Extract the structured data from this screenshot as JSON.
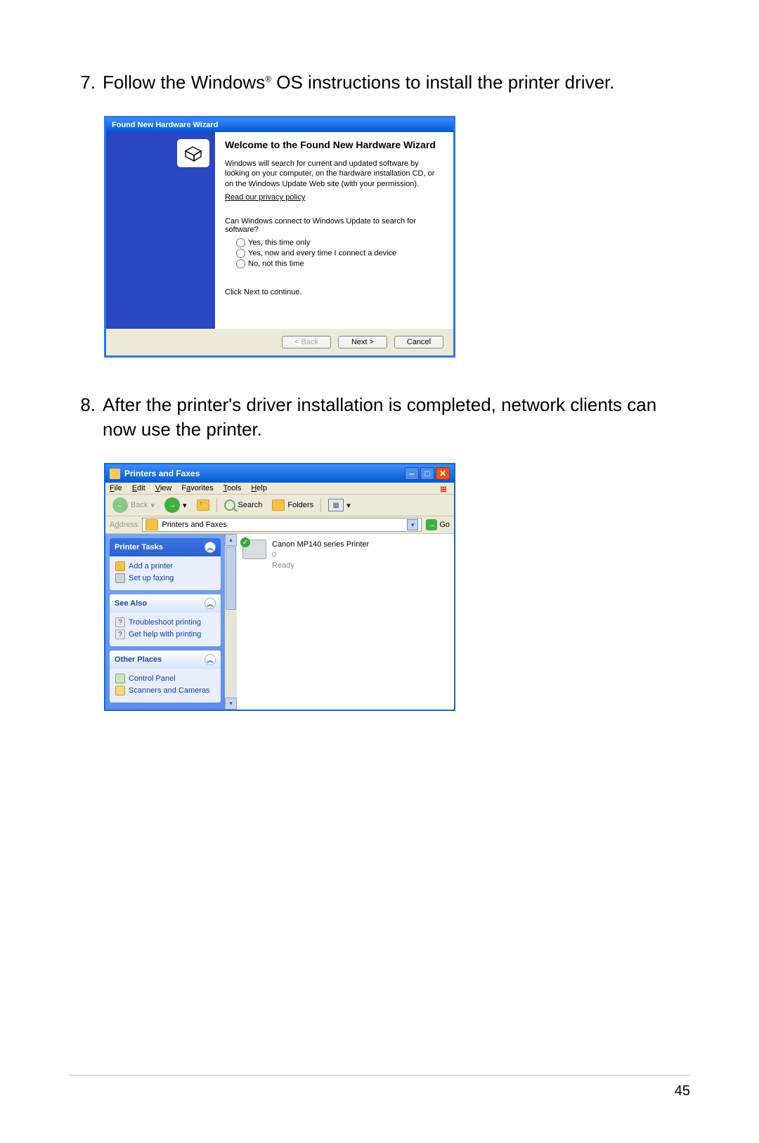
{
  "steps": {
    "s7_num": "7.",
    "s7_a": "Follow the Windows",
    "s7_reg": "®",
    "s7_b": " OS instructions to install the printer driver.",
    "s8_num": "8.",
    "s8": "After the printer's driver installation is completed, network clients can now use the printer."
  },
  "wizard": {
    "title": "Found New Hardware Wizard",
    "heading": "Welcome to the Found New Hardware Wizard",
    "para": "Windows will search for current and updated software by looking on your computer, on the hardware installation CD, or on the Windows Update Web site (with your permission).",
    "privacy": "Read our privacy policy",
    "question": "Can Windows connect to Windows Update to search for software?",
    "opt1": "Yes, this time only",
    "opt2": "Yes, now and every time I connect a device",
    "opt3": "No, not this time",
    "next_text": "Click Next to continue.",
    "btn_back": "< Back",
    "btn_next": "Next >",
    "btn_cancel": "Cancel"
  },
  "explorer": {
    "title": "Printers and Faxes",
    "menu": {
      "file": "File",
      "edit": "Edit",
      "view": "View",
      "favorites": "Favorites",
      "tools": "Tools",
      "help": "Help"
    },
    "toolbar": {
      "back": "Back",
      "search": "Search",
      "folders": "Folders"
    },
    "address_label": "Address",
    "address_value": "Printers and Faxes",
    "go": "Go",
    "panels": {
      "tasks_title": "Printer Tasks",
      "tasks": {
        "add": "Add a printer",
        "fax": "Set up faxing"
      },
      "seealso_title": "See Also",
      "seealso": {
        "trouble": "Troubleshoot printing",
        "help": "Get help with printing"
      },
      "other_title": "Other Places",
      "other": {
        "cp": "Control Panel",
        "scan": "Scanners and Cameras"
      }
    },
    "printer": {
      "name": "Canon MP140 series Printer",
      "count": "0",
      "status": "Ready"
    }
  },
  "page_number": "45"
}
